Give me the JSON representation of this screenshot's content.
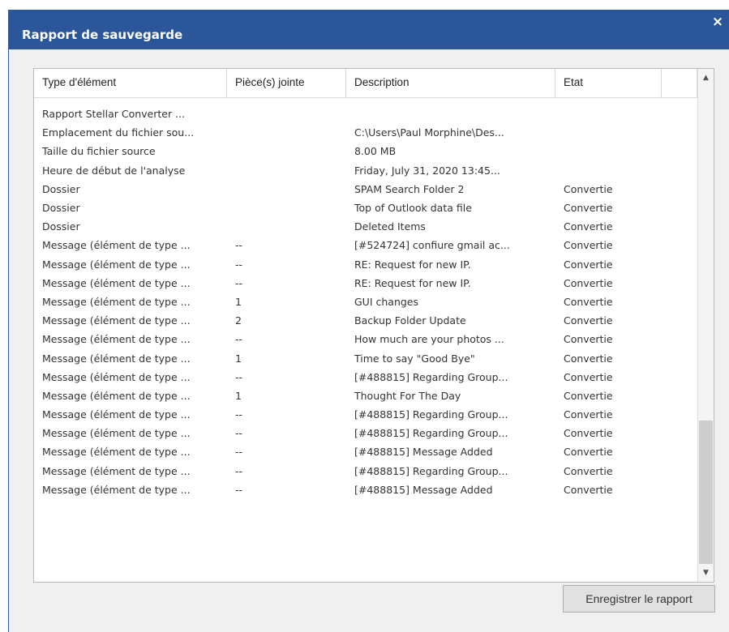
{
  "window": {
    "title": "Rapport de sauvegarde",
    "close_label": "×"
  },
  "table": {
    "columns": [
      "Type d'élément",
      "Pièce(s) jointe",
      "Description",
      "Etat",
      ""
    ],
    "rows": [
      [
        "Rapport Stellar Converter ...",
        "",
        "",
        ""
      ],
      [
        "Emplacement du fichier sou...",
        "",
        "C:\\Users\\Paul Morphine\\Des...",
        ""
      ],
      [
        "Taille du fichier source",
        "",
        "8.00 MB",
        ""
      ],
      [
        "Heure de début de l'analyse",
        "",
        "Friday, July 31, 2020 13:45...",
        ""
      ],
      [
        "Dossier",
        "",
        "SPAM Search Folder 2",
        "Convertie"
      ],
      [
        "Dossier",
        "",
        "Top of Outlook data file",
        "Convertie"
      ],
      [
        "Dossier",
        "",
        "Deleted Items",
        "Convertie"
      ],
      [
        "Message (élément de type ...",
        "--",
        "[#524724] confiure gmail ac...",
        "Convertie"
      ],
      [
        "Message (élément de type ...",
        "--",
        "RE: Request for new IP.",
        "Convertie"
      ],
      [
        "Message (élément de type ...",
        "--",
        "RE: Request for new IP.",
        "Convertie"
      ],
      [
        "Message (élément de type ...",
        "1",
        "GUI changes",
        "Convertie"
      ],
      [
        "Message (élément de type ...",
        "2",
        "Backup Folder Update",
        "Convertie"
      ],
      [
        "Message (élément de type ...",
        "--",
        "How much are your photos ...",
        "Convertie"
      ],
      [
        "Message (élément de type ...",
        "1",
        "Time to say \"Good Bye\"",
        "Convertie"
      ],
      [
        "Message (élément de type ...",
        "--",
        "[#488815] Regarding Group...",
        "Convertie"
      ],
      [
        "Message (élément de type ...",
        "1",
        "Thought For The Day",
        "Convertie"
      ],
      [
        "Message (élément de type ...",
        "--",
        "[#488815] Regarding Group...",
        "Convertie"
      ],
      [
        "Message (élément de type ...",
        "--",
        "[#488815] Regarding Group...",
        "Convertie"
      ],
      [
        "Message (élément de type ...",
        "--",
        "[#488815] Message Added",
        "Convertie"
      ],
      [
        "Message (élément de type ...",
        "--",
        "[#488815] Regarding Group...",
        "Convertie"
      ],
      [
        "Message (élément de type ...",
        "--",
        "[#488815] Message Added",
        "Convertie"
      ]
    ]
  },
  "scrollbar": {
    "up_icon": "chevron-up-icon",
    "down_icon": "chevron-down-icon",
    "thumb_start_fraction": 0.7,
    "thumb_end_fraction": 1.0
  },
  "buttons": {
    "save_report": "Enregistrer le rapport"
  },
  "colors": {
    "title_bar": "#2b579a",
    "dialog_background": "#f0f0f0",
    "button_background": "#e1e1e1"
  }
}
